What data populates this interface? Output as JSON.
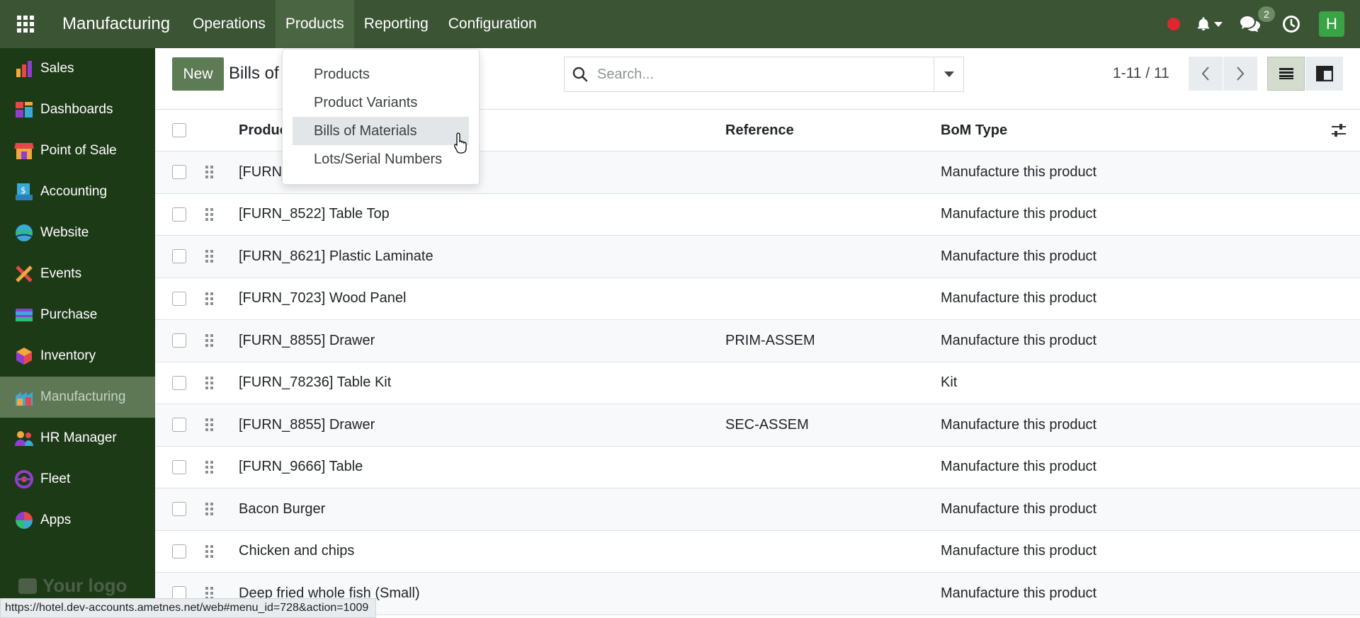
{
  "topbar": {
    "brand": "Manufacturing",
    "menu": [
      "Operations",
      "Products",
      "Reporting",
      "Configuration"
    ],
    "chat_count": "2",
    "avatar_letter": "H"
  },
  "sidebar": {
    "items": [
      "Sales",
      "Dashboards",
      "Point of Sale",
      "Accounting",
      "Website",
      "Events",
      "Purchase",
      "Inventory",
      "Manufacturing",
      "HR Manager",
      "Fleet",
      "Apps"
    ],
    "logo_text": "Your logo"
  },
  "control": {
    "new_label": "New",
    "breadcrumb": "Bills of",
    "search_placeholder": "Search...",
    "pager": "1-11 / 11"
  },
  "dropdown": {
    "items": [
      "Products",
      "Product Variants",
      "Bills of Materials",
      "Lots/Serial Numbers"
    ]
  },
  "table": {
    "headers": [
      "Product",
      "Reference",
      "BoM Type"
    ],
    "rows": [
      {
        "product": "[FURN_",
        "reference": "",
        "type": "Manufacture this product"
      },
      {
        "product": "[FURN_8522] Table Top",
        "reference": "",
        "type": "Manufacture this product"
      },
      {
        "product": "[FURN_8621] Plastic Laminate",
        "reference": "",
        "type": "Manufacture this product"
      },
      {
        "product": "[FURN_7023] Wood Panel",
        "reference": "",
        "type": "Manufacture this product"
      },
      {
        "product": "[FURN_8855] Drawer",
        "reference": "PRIM-ASSEM",
        "type": "Manufacture this product"
      },
      {
        "product": "[FURN_78236] Table Kit",
        "reference": "",
        "type": "Kit"
      },
      {
        "product": "[FURN_8855] Drawer",
        "reference": "SEC-ASSEM",
        "type": "Manufacture this product"
      },
      {
        "product": "[FURN_9666] Table",
        "reference": "",
        "type": "Manufacture this product"
      },
      {
        "product": "Bacon Burger",
        "reference": "",
        "type": "Manufacture this product"
      },
      {
        "product": "Chicken and chips",
        "reference": "",
        "type": "Manufacture this product"
      },
      {
        "product": "Deep fried whole fish (Small)",
        "reference": "",
        "type": "Manufacture this product"
      }
    ]
  },
  "status_url": "https://hotel.dev-accounts.ametnes.net/web#menu_id=728&action=1009"
}
